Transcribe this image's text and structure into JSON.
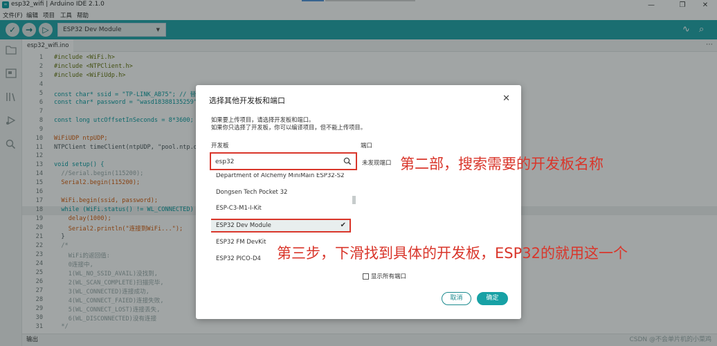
{
  "window": {
    "title": "esp32_wifi | Arduino IDE 2.1.0",
    "app_icon": "∞",
    "minimize": "—",
    "maximize": "❐",
    "close": "✕"
  },
  "menu": [
    "文件(F)",
    "编辑",
    "项目",
    "工具",
    "帮助"
  ],
  "toolbar": {
    "verify_icon": "✓",
    "upload_icon": "→",
    "debug_icon": "▷",
    "board_label": "ESP32 Dev Module",
    "board_caret": "▼",
    "plotter_icon": "∿",
    "monitor_icon": "⌕",
    "accent": "#17a1a5"
  },
  "tab": {
    "filename": "esp32_wifi.ino",
    "more": "⋯"
  },
  "code": {
    "lines": [
      {
        "n": "1",
        "t": "#include <WiFi.h>"
      },
      {
        "n": "2",
        "t": "#include <NTPClient.h>"
      },
      {
        "n": "3",
        "t": "#include <WiFiUdp.h>"
      },
      {
        "n": "4",
        "t": ""
      },
      {
        "n": "5",
        "t": "const char* ssid = \"TP-LINK_AB75\"; // 替"
      },
      {
        "n": "6",
        "t": "const char* password = \"wasd18388135259\""
      },
      {
        "n": "7",
        "t": ""
      },
      {
        "n": "8",
        "t": "const long utcOffsetInSeconds = 8*3600;"
      },
      {
        "n": "9",
        "t": ""
      },
      {
        "n": "10",
        "t": "WiFiUDP ntpUDP;"
      },
      {
        "n": "11",
        "t": "NTPClient timeClient(ntpUDP, \"pool.ntp.o"
      },
      {
        "n": "12",
        "t": ""
      },
      {
        "n": "13",
        "t": "void setup() {"
      },
      {
        "n": "14",
        "t": "  //Serial.begin(115200);"
      },
      {
        "n": "15",
        "t": "  Serial2.begin(115200);"
      },
      {
        "n": "16",
        "t": ""
      },
      {
        "n": "17",
        "t": "  WiFi.begin(ssid, password);"
      },
      {
        "n": "18",
        "t": "  while (WiFi.status() != WL_CONNECTED)"
      },
      {
        "n": "19",
        "t": "    delay(1000);"
      },
      {
        "n": "20",
        "t": "    Serial2.println(\"连接到WiFi...\");"
      },
      {
        "n": "21",
        "t": "  }"
      },
      {
        "n": "22",
        "t": "  /*"
      },
      {
        "n": "23",
        "t": "    WiFi的返回值:"
      },
      {
        "n": "24",
        "t": "    0连接中,"
      },
      {
        "n": "25",
        "t": "    1(WL_NO_SSID_AVAIL)没找到,"
      },
      {
        "n": "26",
        "t": "    2(WL_SCAN_COMPLETE)扫描完毕,"
      },
      {
        "n": "27",
        "t": "    3(WL_CONNECTED)连接成功,"
      },
      {
        "n": "28",
        "t": "    4(WL_CONNECT_FAIED)连接失败,"
      },
      {
        "n": "29",
        "t": "    5(WL_CONNECT_LOST)连接丢失,"
      },
      {
        "n": "30",
        "t": "    6(WL_DISCONNECTED)没有连接"
      },
      {
        "n": "31",
        "t": "  */"
      }
    ]
  },
  "output": {
    "label": "输出",
    "watermark": "CSDN @不会单片机的小菜鸡"
  },
  "dialog": {
    "title": "选择其他开发板和端口",
    "close": "✕",
    "desc1": "如果要上传项目，请选择开发板和端口。",
    "desc2": "如果你只选择了开发板，你可以编译项目，但不能上传项目。",
    "boards_label": "开发板",
    "ports_label": "端口",
    "search_value": "esp32",
    "no_ports": "未发现端口",
    "boards": [
      "Department of Alchemy MiniMain ESP32-S2",
      "Dongsen Tech Pocket 32",
      "ESP-C3-M1-I-Kit",
      "ESP32 Dev Module",
      "ESP32 FM DevKit",
      "ESP32 PICO-D4"
    ],
    "selected_check": "✔",
    "show_all_ports": "显示所有端口",
    "cancel": "取消",
    "ok": "确定"
  },
  "annotations": {
    "step2": "第二部，搜索需要的开发板名称",
    "step3": "第三步，下滑找到具体的开发板，ESP32的就用这一个",
    "color": "#d9362b"
  }
}
